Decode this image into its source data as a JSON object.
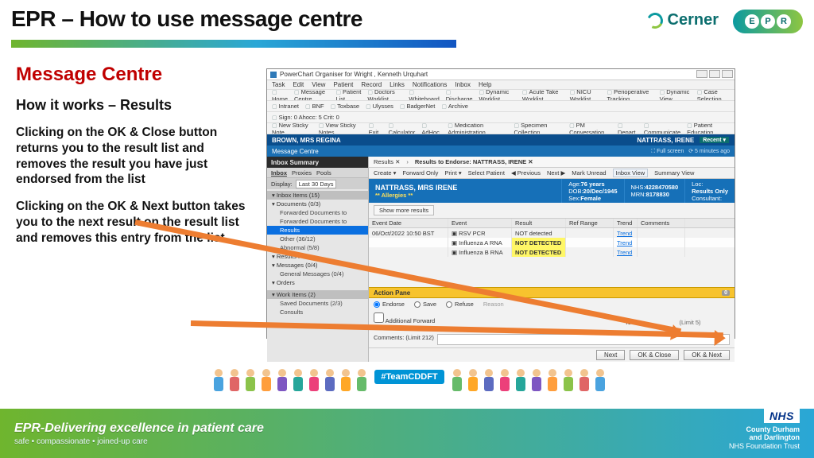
{
  "slide": {
    "title": "EPR – How to use message centre",
    "logo_cerner": "Cerner",
    "logo_epr_letters": [
      "E",
      "P",
      "R"
    ],
    "heading": "Message Centre",
    "subheading": "How it works – Results",
    "para1": "Clicking on the OK & Close button returns you to the result list and removes the result you have just endorsed from the list",
    "para2": "Clicking on the OK & Next button takes you to the next result on the result list and removes this entry from the list",
    "hashtag": "#TeamCDDFT"
  },
  "app": {
    "window_title": "PowerChart Organiser for Wright , Kenneth Urquhart",
    "menus": [
      "Task",
      "Edit",
      "View",
      "Patient",
      "Record",
      "Links",
      "Notifications",
      "Inbox",
      "Help"
    ],
    "toolbar1": [
      "Home",
      "Message Centre",
      "Patient List",
      "Doctors Worklist",
      "Whiteboard",
      "Discharge",
      "Dynamic Worklist",
      "Acute Take Worklist",
      "NICU Worklist",
      "Perioperative Tracking",
      "Dynamic View",
      "Case Selection"
    ],
    "toolbar2": [
      "Intranet",
      "BNF",
      "Toxbase",
      "Ulysses",
      "BadgerNet",
      "Archive"
    ],
    "toolbar3_prefix": "Sign: 0  Ahocc: 5  Crit: 0",
    "toolbar4": [
      "New Sticky Note",
      "View Sticky Notes",
      "Exit",
      "Calculator",
      "AdHoc",
      "Medication Administration",
      "Specimen Collection",
      "PM Conversation",
      "Depart",
      "Communicate",
      "Patient Education"
    ],
    "patient_bar_left": "BROWN, MRS REGINA",
    "patient_bar_right": "NATTRASS, IRENE",
    "recent_btn": "Recent ▾",
    "mc_title": "Message Centre",
    "mc_fullscreen": "⛶ Full screen",
    "mc_ago": "⟳  5 minutes ago",
    "inbox": {
      "header": "Inbox Summary",
      "tabs": [
        "Inbox",
        "Proxies",
        "Pools"
      ],
      "display_label": "Display:",
      "display_value": "Last 30 Days",
      "groups": [
        {
          "label": "Inbox Items (15)",
          "cls": "top"
        },
        {
          "label": "Documents (0/3)"
        },
        {
          "label": "Forwarded Documents to",
          "indent": true
        },
        {
          "label": "Forwarded Documents to",
          "indent": true
        },
        {
          "label": "Results",
          "sel": true,
          "indent": true
        },
        {
          "label": "Other (36/12)",
          "indent": true
        },
        {
          "label": "Abnormal (5/8)",
          "indent": true
        },
        {
          "label": "Results FYI"
        },
        {
          "label": "Messages (0/4)"
        },
        {
          "label": "General Messages (0/4)",
          "indent": true
        },
        {
          "label": "Orders"
        }
      ],
      "groups2": [
        {
          "label": "Work Items (2)",
          "cls": "top"
        },
        {
          "label": "Saved Documents (2/3)",
          "indent": true
        },
        {
          "label": "Consults",
          "indent": true
        }
      ]
    },
    "crumbs": {
      "a": "Results  ✕",
      "b": "Results to Endorse: NATTRASS, IRENE   ✕"
    },
    "cmdbar": [
      "Create ▾",
      "Forward Only",
      "Print ▾",
      "Select Patient",
      "◀ Previous",
      "Next ▶",
      "Mark Unread",
      "Inbox View",
      "Summary View"
    ],
    "banner": {
      "name": "NATTRASS, MRS IRENE",
      "allergies": "** Allergies **",
      "age_lbl": "Age:",
      "age": "76 years",
      "dob_lbl": "DOB:",
      "dob": "20/Dec/1945",
      "sex_lbl": "Sex:",
      "sex": "Female",
      "nhs_lbl": "NHS:",
      "nhs": "4228470580",
      "mrn_lbl": "MRN:",
      "mrn": "8178830",
      "loc_lbl": "Loc:",
      "res_lbl": "Results Only",
      "cons_lbl": "Consultant:"
    },
    "show_more": "Show more results",
    "table": {
      "headers": [
        "Event Date",
        "Event",
        "Result",
        "Ref Range",
        "Trend",
        "Comments"
      ],
      "rows": [
        {
          "date": "06/Oct/2022 10:50 BST",
          "event": "RSV PCR",
          "result": "NOT detected",
          "hl": false
        },
        {
          "date": "",
          "event": "Influenza A RNA",
          "result": "NOT DETECTED",
          "hl": true
        },
        {
          "date": "",
          "event": "Influenza B RNA",
          "result": "NOT DETECTED",
          "hl": true
        }
      ],
      "trend_label": "Trend"
    },
    "action_pane": "Action Pane",
    "action_badge": "0",
    "endorse": {
      "e": "Endorse",
      "s": "Save",
      "r": "Refuse",
      "reason": "Reason"
    },
    "fwd": {
      "chk": "Additional Forward Action:",
      "to": "To*:",
      "limit": "(Limit 5)",
      "comm": "Comments: (Limit 212)",
      "due": "Due:"
    },
    "btns": {
      "next": "Next",
      "okclose": "OK & Close",
      "oknext": "OK & Next"
    }
  },
  "footer": {
    "line1": "EPR-Delivering excellence in patient care",
    "line2": "safe • compassionate • joined-up care",
    "nhs": "NHS",
    "trust1": "County Durham",
    "trust2": "and Darlington",
    "trust3": "NHS Foundation Trust"
  }
}
